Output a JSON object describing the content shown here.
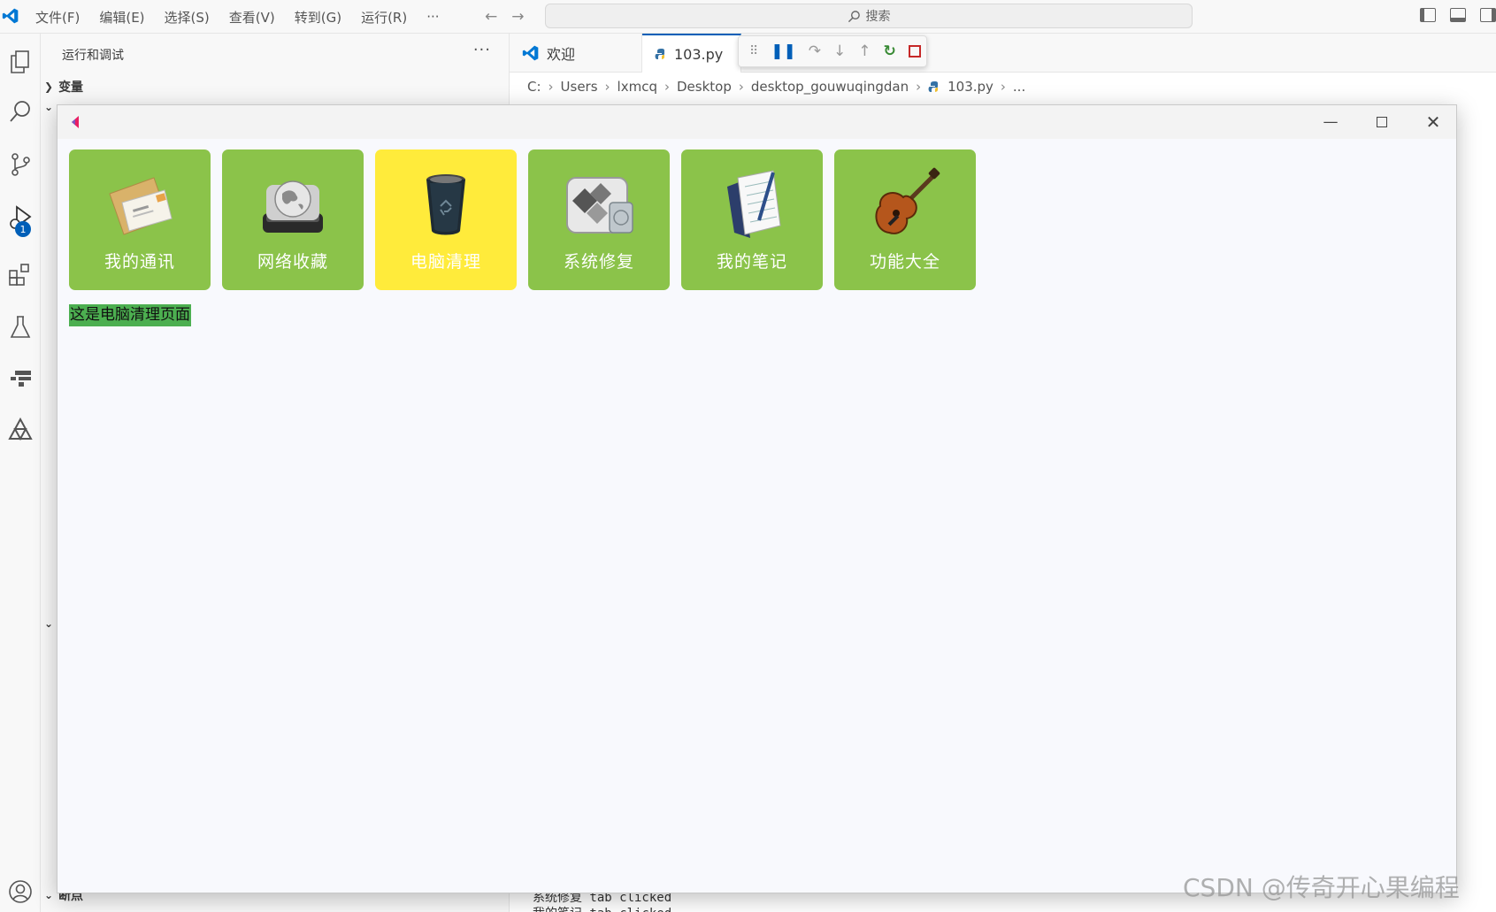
{
  "titlebar": {
    "menu": [
      "文件(F)",
      "编辑(E)",
      "选择(S)",
      "查看(V)",
      "转到(G)",
      "运行(R)",
      "···"
    ],
    "search_placeholder": "搜索"
  },
  "activitybar": {
    "debug_badge": "1"
  },
  "sidebar": {
    "title": "运行和调试",
    "more": "···",
    "section_variables": "变量",
    "section_breakpoints": "断点"
  },
  "editor": {
    "tabs": [
      {
        "label": "欢迎",
        "active": false
      },
      {
        "label": "103.py",
        "active": true
      }
    ],
    "breadcrumb": [
      "C:",
      "Users",
      "lxmcq",
      "Desktop",
      "desktop_gouwuqingdan",
      "103.py",
      "..."
    ],
    "panel_lines": [
      "系统修复 tab clicked",
      "我的笔记 tab clicked"
    ]
  },
  "app_window": {
    "tiles": [
      {
        "label": "我的通讯",
        "icon": "mail-envelope-icon",
        "selected": false
      },
      {
        "label": "网络收藏",
        "icon": "globe-drive-icon",
        "selected": false
      },
      {
        "label": "电脑清理",
        "icon": "trash-bin-icon",
        "selected": true
      },
      {
        "label": "系统修复",
        "icon": "system-disk-icon",
        "selected": false
      },
      {
        "label": "我的笔记",
        "icon": "notebook-pen-icon",
        "selected": false
      },
      {
        "label": "功能大全",
        "icon": "guitar-icon",
        "selected": false
      }
    ],
    "status_message": "这是电脑清理页面"
  },
  "colors": {
    "tile_green": "#8bc34a",
    "tile_selected": "#ffeb3b",
    "status_bg": "#4caf50",
    "vscode_blue": "#005fb8"
  },
  "watermark": "CSDN @传奇开心果编程"
}
